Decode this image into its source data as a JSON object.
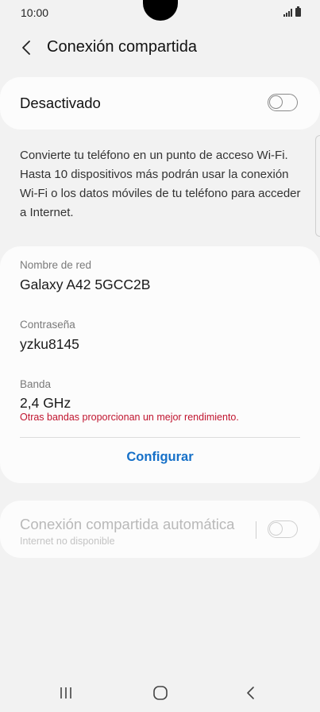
{
  "status_bar": {
    "time": "10:00"
  },
  "header": {
    "title": "Conexión compartida",
    "back_icon": "chevron-left-icon"
  },
  "hotspot_toggle": {
    "label": "Desactivado",
    "state": "off"
  },
  "description": "Convierte tu teléfono en un punto de acceso Wi-Fi. Hasta 10 dispositivos más podrán usar la conexión Wi-Fi o los datos móviles de tu teléfono para acceder a Internet.",
  "network": {
    "name_label": "Nombre de red",
    "name_value": "Galaxy A42 5GCC2B",
    "password_label": "Contraseña",
    "password_value": "yzku8145",
    "band_label": "Banda",
    "band_value": "2,4 GHz",
    "band_warning": "Otras bandas proporcionan un mejor rendimiento.",
    "configure_label": "Configurar"
  },
  "auto_hotspot": {
    "label": "Conexión compartida automática",
    "sublabel": "Internet no disponible",
    "state": "off-disabled"
  },
  "colors": {
    "accent": "#1570c8",
    "warning": "#c0152f",
    "background": "#f2f2f2",
    "card": "#fcfcfc"
  },
  "nav_bar": {
    "icons": [
      "recent-apps-icon",
      "home-icon",
      "back-icon"
    ]
  }
}
